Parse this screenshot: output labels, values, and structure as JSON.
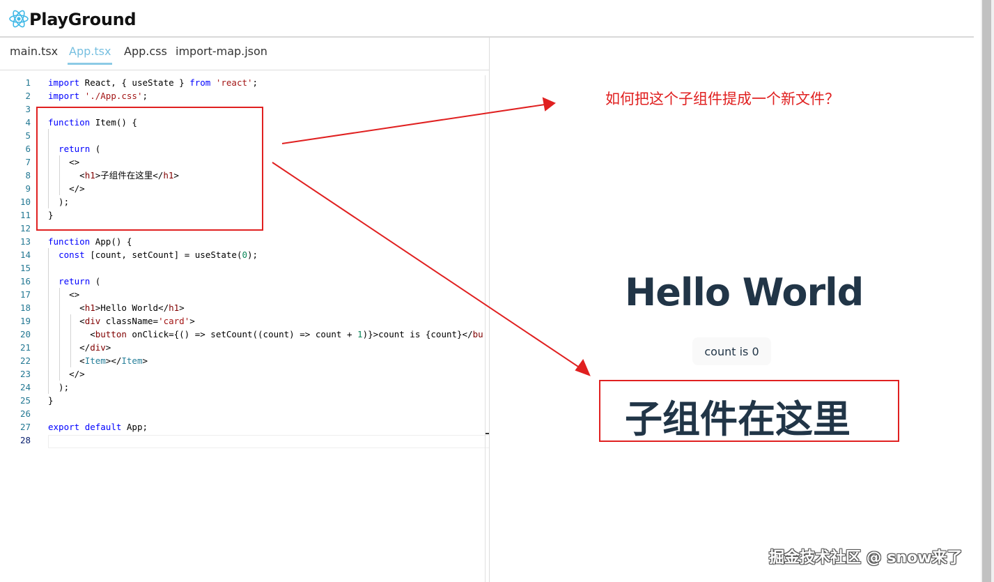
{
  "header": {
    "title": "PlayGround",
    "logo_icon": "react-logo-icon"
  },
  "tabs": [
    {
      "label": "main.tsx",
      "active": false
    },
    {
      "label": "App.tsx",
      "active": true
    },
    {
      "label": "App.css",
      "active": false
    },
    {
      "label": "import-map.json",
      "active": false
    }
  ],
  "editor": {
    "active_line": 28,
    "lines": [
      "import React, { useState } from 'react';",
      "import './App.css';",
      "",
      "function Item() {",
      "",
      "  return (",
      "    <>",
      "      <h1>子组件在这里</h1>",
      "    </>",
      "  );",
      "}",
      "",
      "function App() {",
      "  const [count, setCount] = useState(0);",
      "",
      "  return (",
      "    <>",
      "      <h1>Hello World</h1>",
      "      <div className='card'>",
      "        <button onClick={() => setCount((count) => count + 1)}>count is {count}</bu",
      "      </div>",
      "      <Item></Item>",
      "    </>",
      "  );",
      "}",
      "",
      "export default App;",
      ""
    ]
  },
  "preview": {
    "heading": "Hello World",
    "button_label": "count is 0",
    "item_heading": "子组件在这里"
  },
  "annotation": {
    "text": "如何把这个子组件提成一个新文件？",
    "color": "#e02020"
  },
  "watermark": "掘金技术社区 @ snow来了"
}
